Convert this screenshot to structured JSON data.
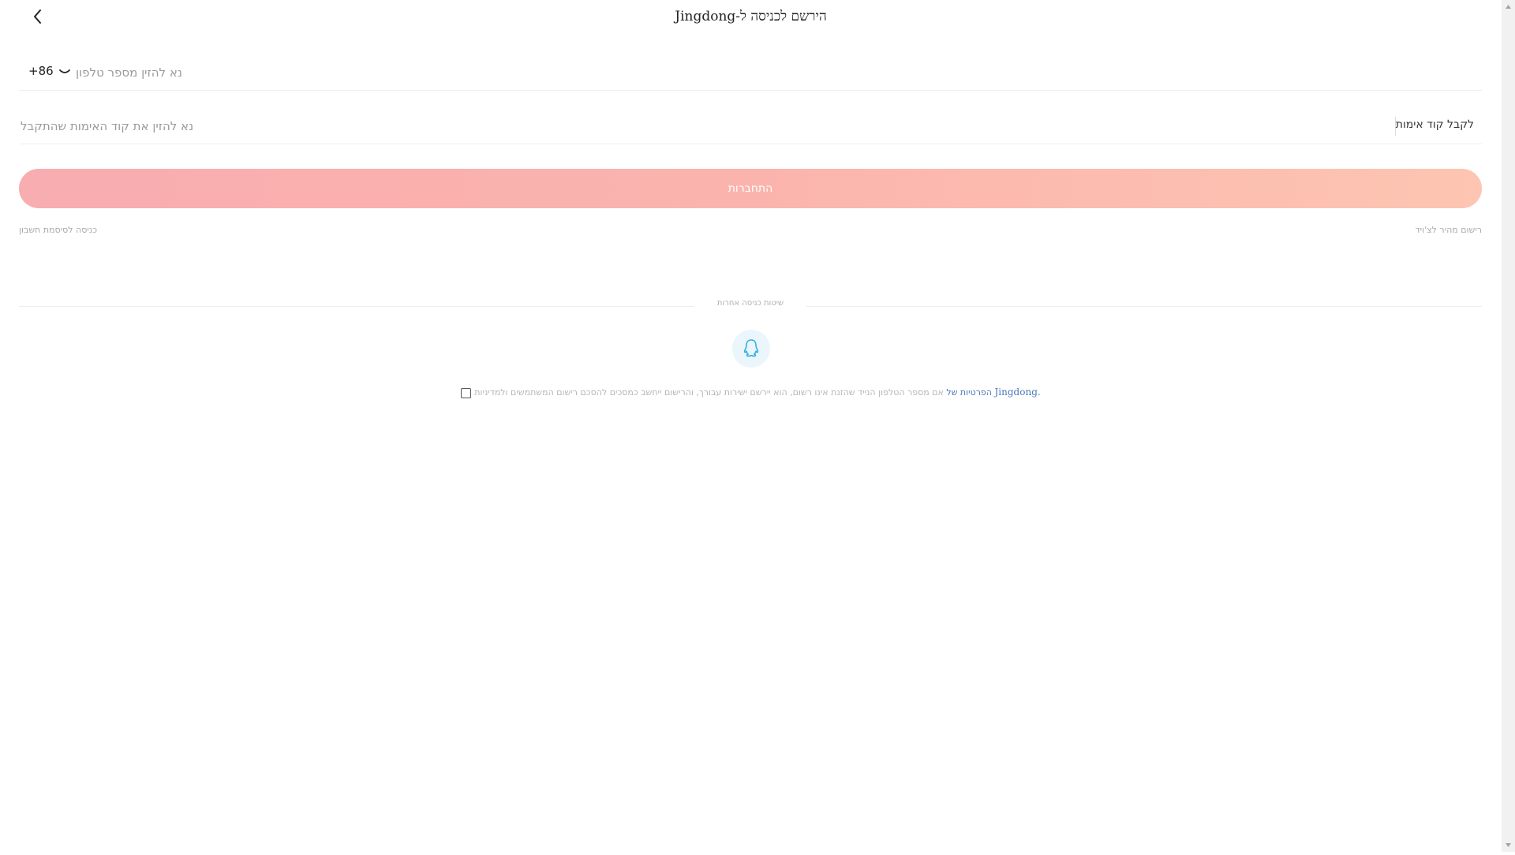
{
  "header": {
    "title": "הירשם לכניסה ל-Jingdong",
    "back_icon": "chevron-left-icon"
  },
  "phone": {
    "country_code": "+86",
    "placeholder": "נא להזין מספר טלפון",
    "value": ""
  },
  "code": {
    "placeholder": "נא להזין את קוד האימות שהתקבל",
    "value": "",
    "get_code_label": "לקבל קוד אימות"
  },
  "login": {
    "label": "התחברות"
  },
  "links": {
    "account_password": "כניסה לסיסמת חשבון",
    "quick_register": "רישום מהיר לצ'ויד"
  },
  "other_methods": {
    "label": "שיטות כניסה אחרות",
    "qq_icon": "qq-penguin-icon"
  },
  "agreement": {
    "prefix": "אם מספר הטלפון הנייד שהזנת אינו רשום, הוא יירשם ישירות עבורך, והרישום ייחשב כמסכים להסכם רישום המשתמשים ולמדיניות",
    "privacy_link": "הפרטיות של",
    "brand": "Jingdong."
  },
  "colors": {
    "login_gradient_start": "#f8adb0",
    "login_gradient_end": "#fdc5b2",
    "link_blue": "#4a78b8",
    "qq_bg": "#eaf6fc",
    "qq_icon": "#2fb0e0"
  }
}
